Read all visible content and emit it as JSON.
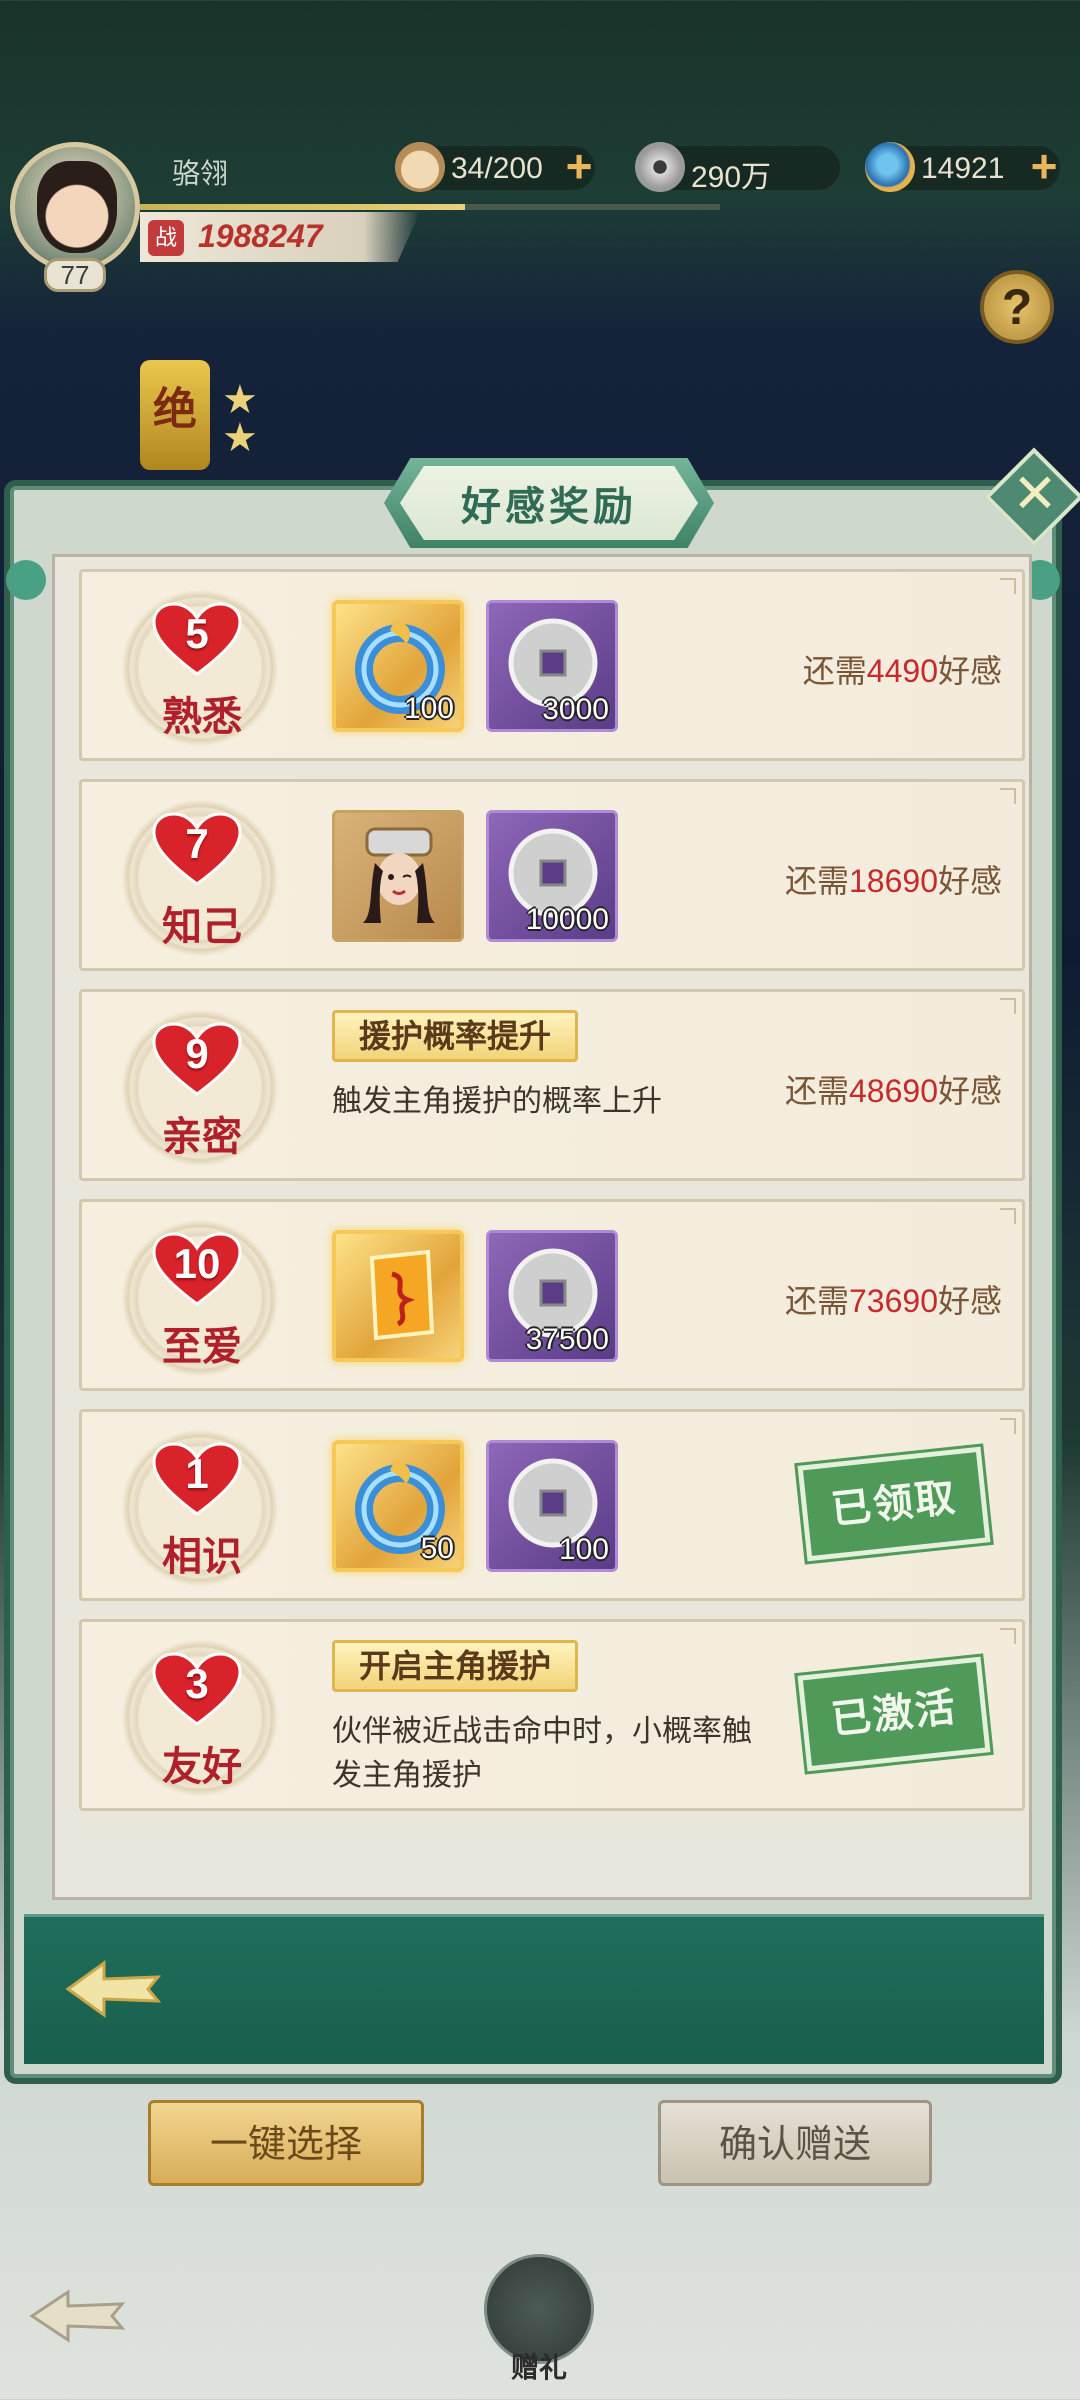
{
  "player": {
    "name": "骆翎",
    "level": "77",
    "power": "1988247",
    "power_icon_char": "战"
  },
  "resources": {
    "food": "34/200",
    "coins": "290万",
    "gems": "14921"
  },
  "rank_badge_char": "绝",
  "help_label": "?",
  "modal": {
    "title": "好感奖励",
    "close_label": "✕",
    "rows": [
      {
        "level": "5",
        "name": "熟悉",
        "rewards": [
          {
            "icon": "jade-ring-icon",
            "qty": "100"
          },
          {
            "icon": "silver-coin-icon",
            "qty": "3000"
          }
        ],
        "need_prefix": "还需",
        "need_value": "4490",
        "need_suffix": "好感"
      },
      {
        "level": "7",
        "name": "知己",
        "rewards": [
          {
            "icon": "character-portrait-icon",
            "qty": ""
          },
          {
            "icon": "silver-coin-icon",
            "qty": "10000"
          }
        ],
        "need_prefix": "还需",
        "need_value": "18690",
        "need_suffix": "好感"
      },
      {
        "level": "9",
        "name": "亲密",
        "buff_title": "援护概率提升",
        "buff_desc": "触发主角援护的概率上升",
        "need_prefix": "还需",
        "need_value": "48690",
        "need_suffix": "好感"
      },
      {
        "level": "10",
        "name": "至爱",
        "rewards": [
          {
            "icon": "scroll-card-icon",
            "qty": ""
          },
          {
            "icon": "silver-coin-icon",
            "qty": "37500"
          }
        ],
        "need_prefix": "还需",
        "need_value": "73690",
        "need_suffix": "好感"
      },
      {
        "level": "1",
        "name": "相识",
        "rewards": [
          {
            "icon": "jade-ring-icon",
            "qty": "50"
          },
          {
            "icon": "silver-coin-icon",
            "qty": "100"
          }
        ],
        "stamp": "已领取"
      },
      {
        "level": "3",
        "name": "友好",
        "buff_title": "开启主角援护",
        "buff_desc": "伙伴被近战击命中时，小概率触发主角援护",
        "stamp": "已激活"
      }
    ]
  },
  "buttons": {
    "select": "一键选择",
    "confirm": "确认赠送",
    "gift": "赠礼"
  },
  "colors": {
    "modal_green": "#3f8268",
    "need_red": "#c62a2a",
    "stamp_green": "#4f9a58",
    "heart_red": "#d8232b"
  }
}
